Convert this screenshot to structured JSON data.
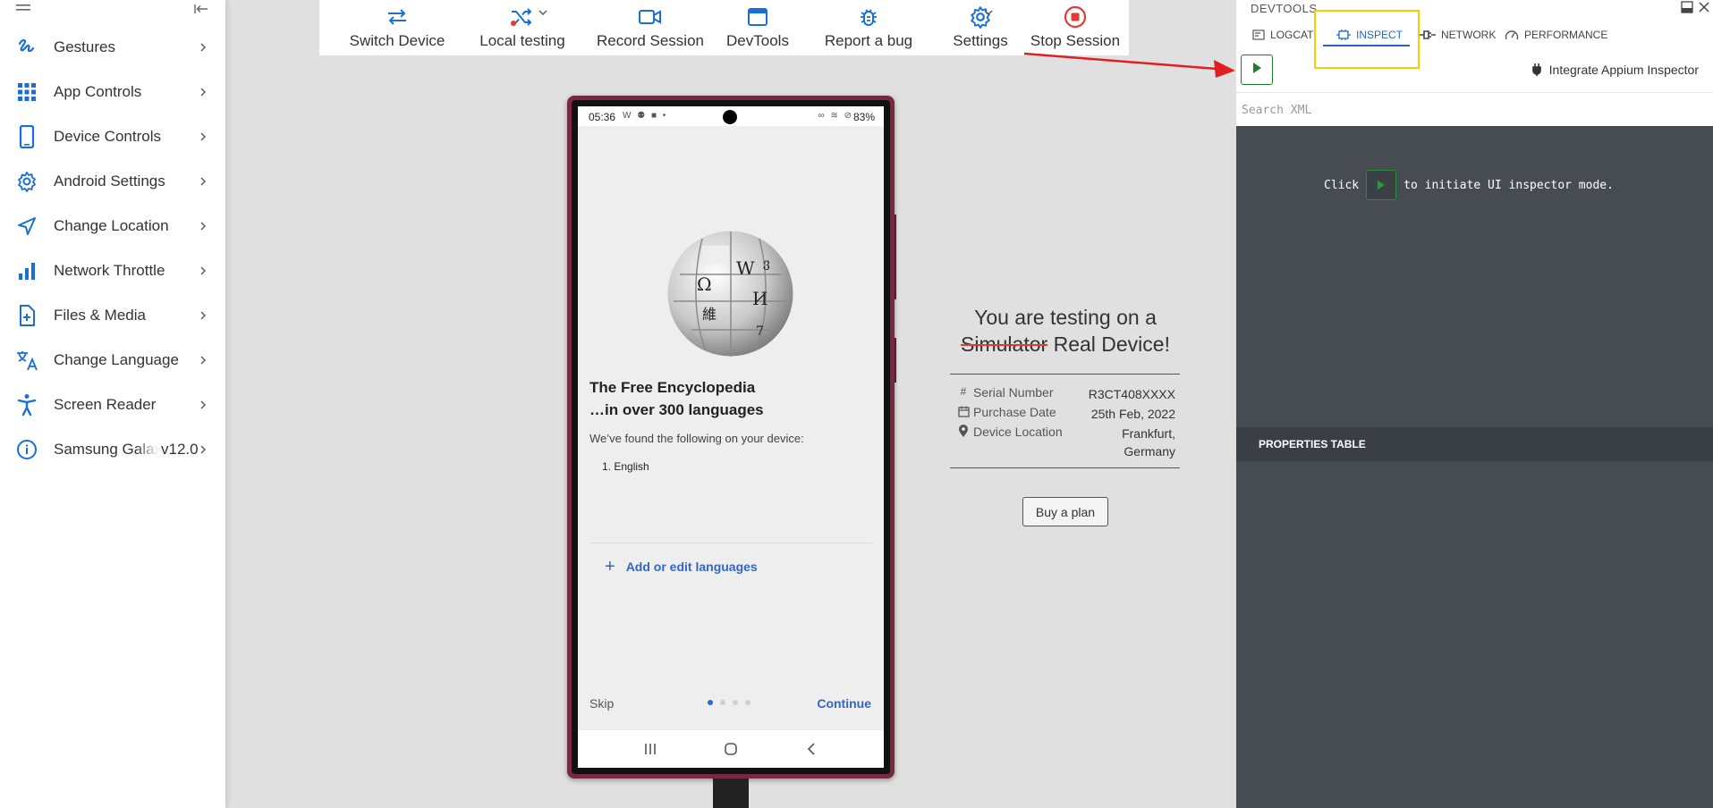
{
  "sidebar": {
    "items": [
      {
        "label": "Gestures",
        "icon": "gesture-icon"
      },
      {
        "label": "App Controls",
        "icon": "grid-icon"
      },
      {
        "label": "Device Controls",
        "icon": "phone-icon"
      },
      {
        "label": "Android Settings",
        "icon": "gear-icon"
      },
      {
        "label": "Change Location",
        "icon": "navigation-icon"
      },
      {
        "label": "Network Throttle",
        "icon": "signal-bars-icon"
      },
      {
        "label": "Files & Media",
        "icon": "file-add-icon"
      },
      {
        "label": "Change Language",
        "icon": "translate-icon"
      },
      {
        "label": "Screen Reader",
        "icon": "accessibility-icon"
      }
    ],
    "device": {
      "name": "Samsung Galaxy",
      "version": "v12.0",
      "icon": "info-icon"
    }
  },
  "toolbar": {
    "items": [
      {
        "label": "Switch Device",
        "icon": "swap-arrows-icon"
      },
      {
        "label": "Local testing",
        "icon": "shuffle-icon"
      },
      {
        "label": "Record Session",
        "icon": "video-camera-icon"
      },
      {
        "label": "DevTools",
        "icon": "window-icon"
      },
      {
        "label": "Report a bug",
        "icon": "bug-icon"
      },
      {
        "label": "Settings",
        "icon": "gear-icon"
      },
      {
        "label": "Stop Session",
        "icon": "stop-icon"
      }
    ]
  },
  "phone": {
    "status": {
      "time": "05:36",
      "left_icons": "W ⚉ ■ •",
      "right_icons": "∞ ≋ ⊘",
      "battery": "83%"
    },
    "wiki": {
      "title_line1": "The Free Encyclopedia",
      "title_line2": "…in over 300 languages",
      "found": "We’ve found the following on your device:",
      "language": "1.   English",
      "add_languages": "Add or edit languages",
      "skip": "Skip",
      "continue": "Continue"
    }
  },
  "info": {
    "heading_line1": "You are testing on a",
    "heading_strike": "Simulator",
    "heading_rest": " Real Device!",
    "rows": [
      {
        "icon": "#",
        "label": "Serial Number",
        "value": "R3CT408XXXX"
      },
      {
        "icon": "calendar-icon",
        "label": "Purchase Date",
        "value": "25th Feb, 2022"
      },
      {
        "icon": "location-pin-icon",
        "label": "Device Location",
        "value_line1": "Frankfurt,",
        "value_line2": "Germany"
      }
    ],
    "buy_label": "Buy a plan"
  },
  "devtools": {
    "title": "DEVTOOLS",
    "tabs": [
      {
        "label": "LOGCAT",
        "icon": "logcat-icon"
      },
      {
        "label": "INSPECT",
        "icon": "chip-icon",
        "active": true
      },
      {
        "label": "NETWORK",
        "icon": "plug-icon"
      },
      {
        "label": "PERFORMANCE",
        "icon": "gauge-icon"
      }
    ],
    "appium_label": "Integrate Appium Inspector",
    "search_placeholder": "Search XML",
    "msg_before": "Click",
    "msg_after": "to initiate UI inspector mode.",
    "properties_label": "PROPERTIES TABLE"
  },
  "colors": {
    "accent": "#1a6fd6",
    "stop": "#e53935",
    "play": "#1a7f30",
    "highlight": "#f0d000",
    "devtools_bg": "#474c53"
  }
}
